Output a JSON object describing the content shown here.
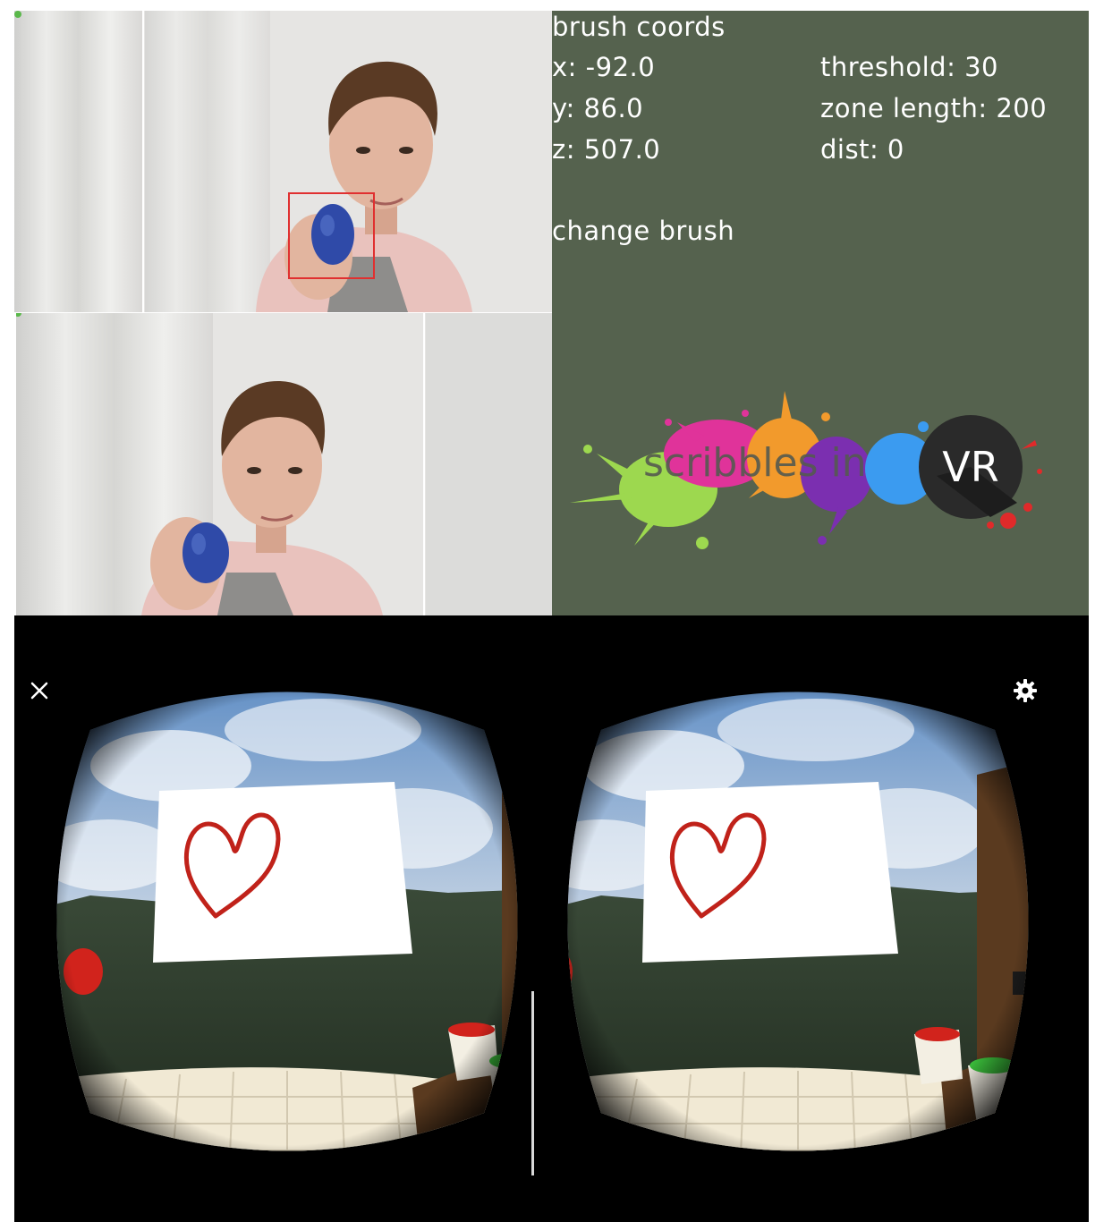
{
  "info": {
    "title": "brush coords",
    "x": "x: -92.0",
    "y": "y: 86.0",
    "z": "z: 507.0",
    "threshold": "threshold: 30",
    "zone_length": "zone length: 200",
    "dist": "dist: 0",
    "change_brush": "change brush"
  },
  "logo": {
    "wordmark": "scribbles in",
    "badge": "VR",
    "splash_colors": [
      "#9dd84f",
      "#e0339a",
      "#f29a2c",
      "#7b2fb0",
      "#3b9bf0",
      "#e02a2a"
    ]
  },
  "vr": {
    "close_icon": "close-icon",
    "settings_icon": "gear-icon"
  },
  "colors": {
    "panel_bg": "#55624e",
    "tracking_box": "#e03030",
    "heart_stroke": "#c0221a",
    "viewer_bg": "#000000"
  }
}
